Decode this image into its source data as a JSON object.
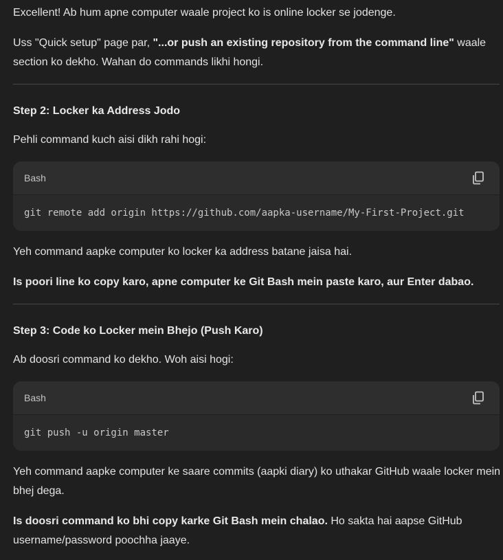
{
  "intro": {
    "line1": "Excellent! Ab hum apne computer waale project ko is online locker se jodenge.",
    "line2_pre": "Uss \"Quick setup\" page par, ",
    "line2_bold": "\"...or push an existing repository from the command line\"",
    "line2_post": " waale section ko dekho. Wahan do commands likhi hongi."
  },
  "step2": {
    "heading": "Step 2: Locker ka Address Jodo",
    "lead": "Pehli command kuch aisi dikh rahi hogi:",
    "code_lang": "Bash",
    "code": "git remote add origin https://github.com/aapka-username/My-First-Project.git",
    "explain": "Yeh command aapke computer ko locker ka address batane jaisa hai.",
    "instruction_bold": "Is poori line ko copy karo, apne computer ke Git Bash mein paste karo, aur Enter dabao."
  },
  "step3": {
    "heading": "Step 3: Code ko Locker mein Bhejo (Push Karo)",
    "lead": "Ab doosri command ko dekho. Woh aisi hogi:",
    "code_lang": "Bash",
    "code": "git push -u origin master",
    "explain": "Yeh command aapke computer ke saare commits (aapki diary) ko uthakar GitHub waale locker mein bhej dega.",
    "instruction_bold": "Is doosri command ko bhi copy karke Git Bash mein chalao.",
    "instruction_rest": " Ho sakta hai aapse GitHub username/password poochha jaaye."
  },
  "icons": {
    "copy": "copy-icon"
  },
  "colors": {
    "background": "#1f1f1f",
    "text": "#e3e3e3",
    "code_bg": "#2a2a2a",
    "code_header_bg": "#2e2e2e",
    "divider": "#474747"
  }
}
